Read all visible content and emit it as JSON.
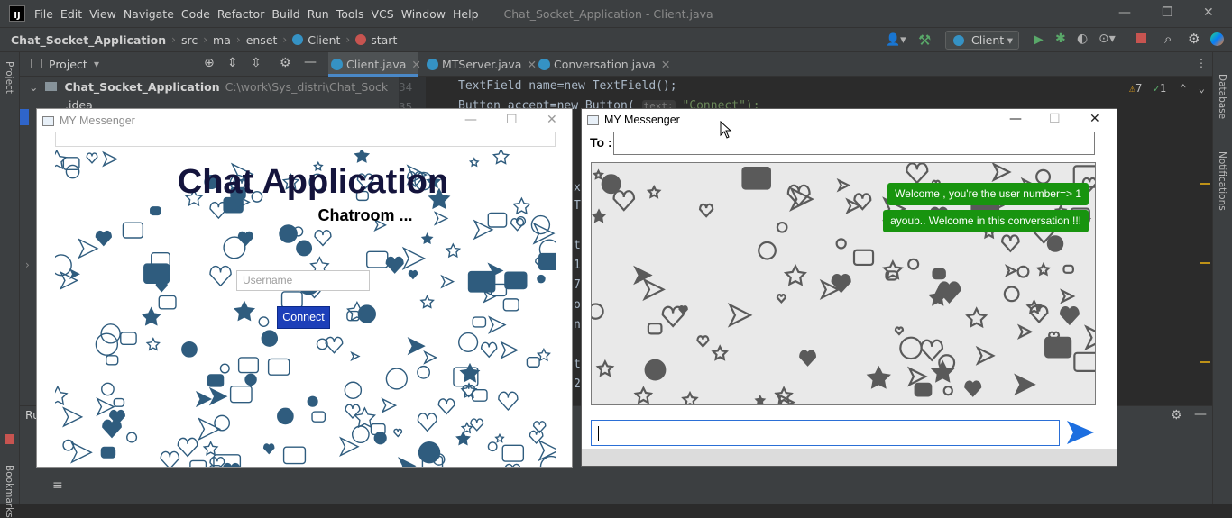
{
  "ide": {
    "menu": [
      "File",
      "Edit",
      "View",
      "Navigate",
      "Code",
      "Refactor",
      "Build",
      "Run",
      "Tools",
      "VCS",
      "Window",
      "Help"
    ],
    "window_title": "Chat_Socket_Application - Client.java",
    "breadcrumbs": [
      "Chat_Socket_Application",
      "src",
      "ma",
      "enset",
      "Client",
      "start"
    ],
    "run_config": "Client",
    "project_tool_title": "Project",
    "tabs": [
      "Client.java",
      "MTServer.java",
      "Conversation.java"
    ],
    "project_root": "Chat_Socket_Application",
    "project_root_path": "C:\\work\\Sys_distri\\Chat_Sock",
    "tree_item_idea": ".idea",
    "gutter_lines": [
      "34",
      "35"
    ],
    "code_line_1": "TextField name=new TextField();",
    "code_line_2_prefix": "Button accept=new Button(",
    "code_line_2_hint": "text:",
    "code_line_2_string": "\"Connect\");",
    "inspection_warnings": "7",
    "inspection_ok": "1",
    "left_stripe_project": "Project",
    "left_stripe_bookmarks": "Bookmarks",
    "bottom_panel_label": "Ru",
    "right_stripe_database": "Database",
    "right_stripe_notifications": "Notifications",
    "code_fragments": [
      "x",
      "T",
      "t",
      "1",
      "7",
      "o",
      "n",
      "t",
      "2"
    ]
  },
  "login_window": {
    "title": "MY Messenger",
    "heading": "Chat Application",
    "subheading": "Chatroom ...",
    "username_placeholder": "Username",
    "connect_label": "Connect"
  },
  "chat_window": {
    "title": "MY Messenger",
    "to_label": "To :",
    "to_value": "",
    "messages": [
      "Welcome , you're the user number=> 1",
      "ayoub.. Welcome in this conversation !!!"
    ],
    "message_value": ""
  },
  "colors": {
    "ide_bg": "#2b2b2b",
    "ide_panel": "#3c3f41",
    "connect_button": "#1c3fb9",
    "bubble_green": "#18940f",
    "send_arrow": "#1d6fe0",
    "doodle_blue": "#2f5c7e"
  }
}
